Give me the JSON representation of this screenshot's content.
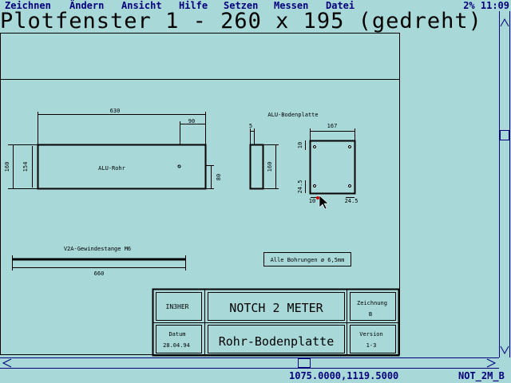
{
  "menu": {
    "items": [
      {
        "label": "Zeichnen"
      },
      {
        "label": "Ändern"
      },
      {
        "label": "Ansicht"
      },
      {
        "label": "Hilfe"
      },
      {
        "label": "Setzen"
      },
      {
        "label": "Messen"
      },
      {
        "label": "Datei"
      }
    ],
    "zoom": "2%",
    "clock": "11:09"
  },
  "window": {
    "title": "Plotfenster 1 - 260 x 195 (gedreht)"
  },
  "drawing": {
    "tube_label": "ALU-Rohr",
    "plate_label": "ALU-Bodenplatte",
    "rod_label": "V2A-Gewindestange M6",
    "note": "Alle Bohrungen ø 6,5mm",
    "dims": {
      "tube_length": "630",
      "tube_offset": "90",
      "tube_outer": "160",
      "tube_inner": "154",
      "tube_hole": "80",
      "side_width": "5",
      "side_height": "160",
      "plate_width": "167",
      "plate_top": "10",
      "plate_left": "24.5",
      "plate_bottom_left": "10",
      "plate_bottom_right": "24.5",
      "rod_length": "660"
    }
  },
  "title_block": {
    "company": "IN3HER",
    "title": "NOTCH 2 METER",
    "subtitle": "Rohr-Bodenplatte",
    "drawing_label": "Zeichnung",
    "drawing_value": "B",
    "date_label": "Datum",
    "date_value": "28.04.94",
    "version_label": "Version",
    "version_value": "1-3"
  },
  "status": {
    "coords": "1075.0000,1119.5000",
    "drawing_name": "NOT_2M_B"
  },
  "colors": {
    "background": "#a8d8d8",
    "menu_text": "#00007c",
    "drawing_line": "#000000"
  }
}
